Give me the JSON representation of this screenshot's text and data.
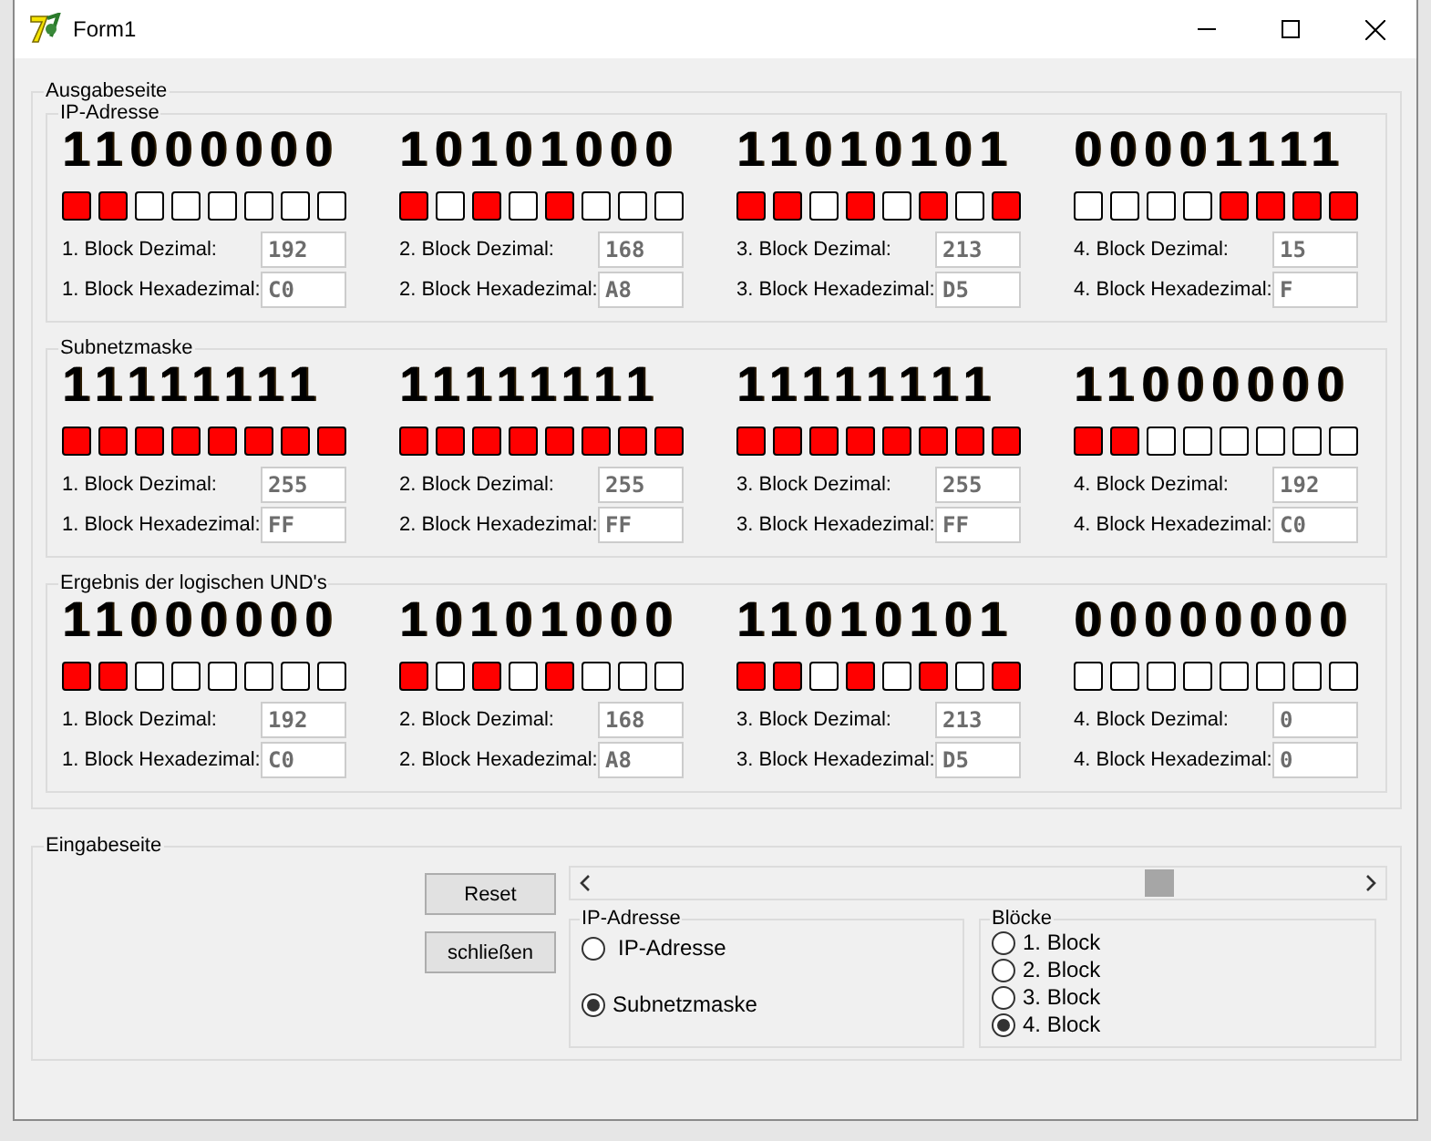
{
  "window": {
    "title": "Form1"
  },
  "output": {
    "title": "Ausgabeseite",
    "groups": [
      {
        "title": "IP-Adresse",
        "blocks": [
          {
            "bits": "11000000",
            "leds": [
              {
                "on": true
              },
              {
                "on": true
              },
              {
                "on": false
              },
              {
                "on": false
              },
              {
                "on": false
              },
              {
                "on": false
              },
              {
                "on": false
              },
              {
                "on": false
              }
            ],
            "dec_label": "1. Block Dezimal:",
            "dec": "192",
            "hex_label": "1. Block Hexadezimal:",
            "hex": "C0"
          },
          {
            "bits": "10101000",
            "leds": [
              {
                "on": true
              },
              {
                "on": false
              },
              {
                "on": true
              },
              {
                "on": false
              },
              {
                "on": true
              },
              {
                "on": false
              },
              {
                "on": false
              },
              {
                "on": false
              }
            ],
            "dec_label": "2. Block Dezimal:",
            "dec": "168",
            "hex_label": "2. Block Hexadezimal:",
            "hex": "A8"
          },
          {
            "bits": "11010101",
            "leds": [
              {
                "on": true
              },
              {
                "on": true
              },
              {
                "on": false
              },
              {
                "on": true
              },
              {
                "on": false
              },
              {
                "on": true
              },
              {
                "on": false
              },
              {
                "on": true
              }
            ],
            "dec_label": "3. Block Dezimal:",
            "dec": "213",
            "hex_label": "3. Block Hexadezimal:",
            "hex": "D5"
          },
          {
            "bits": "00001111",
            "leds": [
              {
                "on": false
              },
              {
                "on": false
              },
              {
                "on": false
              },
              {
                "on": false
              },
              {
                "on": true
              },
              {
                "on": true
              },
              {
                "on": true
              },
              {
                "on": true
              }
            ],
            "dec_label": "4. Block Dezimal:",
            "dec": "15",
            "hex_label": "4. Block Hexadezimal:",
            "hex": "F"
          }
        ]
      },
      {
        "title": "Subnetzmaske",
        "blocks": [
          {
            "bits": "11111111",
            "leds": [
              {
                "on": true
              },
              {
                "on": true
              },
              {
                "on": true
              },
              {
                "on": true
              },
              {
                "on": true
              },
              {
                "on": true
              },
              {
                "on": true
              },
              {
                "on": true
              }
            ],
            "dec_label": "1. Block Dezimal:",
            "dec": "255",
            "hex_label": "1. Block Hexadezimal:",
            "hex": "FF"
          },
          {
            "bits": "11111111",
            "leds": [
              {
                "on": true
              },
              {
                "on": true
              },
              {
                "on": true
              },
              {
                "on": true
              },
              {
                "on": true
              },
              {
                "on": true
              },
              {
                "on": true
              },
              {
                "on": true
              }
            ],
            "dec_label": "2. Block Dezimal:",
            "dec": "255",
            "hex_label": "2. Block Hexadezimal:",
            "hex": "FF"
          },
          {
            "bits": "11111111",
            "leds": [
              {
                "on": true
              },
              {
                "on": true
              },
              {
                "on": true
              },
              {
                "on": true
              },
              {
                "on": true
              },
              {
                "on": true
              },
              {
                "on": true
              },
              {
                "on": true
              }
            ],
            "dec_label": "3. Block Dezimal:",
            "dec": "255",
            "hex_label": "3. Block Hexadezimal:",
            "hex": "FF"
          },
          {
            "bits": "11000000",
            "leds": [
              {
                "on": true
              },
              {
                "on": true
              },
              {
                "on": false
              },
              {
                "on": false
              },
              {
                "on": false
              },
              {
                "on": false
              },
              {
                "on": false
              },
              {
                "on": false
              }
            ],
            "dec_label": "4. Block Dezimal:",
            "dec": "192",
            "hex_label": "4. Block Hexadezimal:",
            "hex": "C0"
          }
        ]
      },
      {
        "title": "Ergebnis der logischen UND's",
        "blocks": [
          {
            "bits": "11000000",
            "leds": [
              {
                "on": true
              },
              {
                "on": true
              },
              {
                "on": false
              },
              {
                "on": false
              },
              {
                "on": false
              },
              {
                "on": false
              },
              {
                "on": false
              },
              {
                "on": false
              }
            ],
            "dec_label": "1. Block Dezimal:",
            "dec": "192",
            "hex_label": "1. Block Hexadezimal:",
            "hex": "C0"
          },
          {
            "bits": "10101000",
            "leds": [
              {
                "on": true
              },
              {
                "on": false
              },
              {
                "on": true
              },
              {
                "on": false
              },
              {
                "on": true
              },
              {
                "on": false
              },
              {
                "on": false
              },
              {
                "on": false
              }
            ],
            "dec_label": "2. Block Dezimal:",
            "dec": "168",
            "hex_label": "2. Block Hexadezimal:",
            "hex": "A8"
          },
          {
            "bits": "11010101",
            "leds": [
              {
                "on": true
              },
              {
                "on": true
              },
              {
                "on": false
              },
              {
                "on": true
              },
              {
                "on": false
              },
              {
                "on": true
              },
              {
                "on": false
              },
              {
                "on": true
              }
            ],
            "dec_label": "3. Block Dezimal:",
            "dec": "213",
            "hex_label": "3. Block Hexadezimal:",
            "hex": "D5"
          },
          {
            "bits": "00000000",
            "leds": [
              {
                "on": false
              },
              {
                "on": false
              },
              {
                "on": false
              },
              {
                "on": false
              },
              {
                "on": false
              },
              {
                "on": false
              },
              {
                "on": false
              },
              {
                "on": false
              }
            ],
            "dec_label": "4. Block Dezimal:",
            "dec": "0",
            "hex_label": "4. Block Hexadezimal:",
            "hex": "0"
          }
        ]
      }
    ]
  },
  "input": {
    "title": "Eingabeseite",
    "buttons": [
      "Reset",
      "schließen"
    ],
    "scrollbar": {
      "level": 0.74
    },
    "address_group": {
      "title": "IP-Adresse",
      "options": [
        {
          "label": "IP-Adresse",
          "selected": false
        },
        {
          "label": "Subnetzmaske",
          "selected": true
        }
      ]
    },
    "block_group": {
      "title": "Blöcke",
      "options": [
        {
          "label": "1. Block",
          "selected": false
        },
        {
          "label": "2. Block",
          "selected": false
        },
        {
          "label": "3. Block",
          "selected": false
        },
        {
          "label": "4. Block",
          "selected": true
        }
      ]
    }
  }
}
